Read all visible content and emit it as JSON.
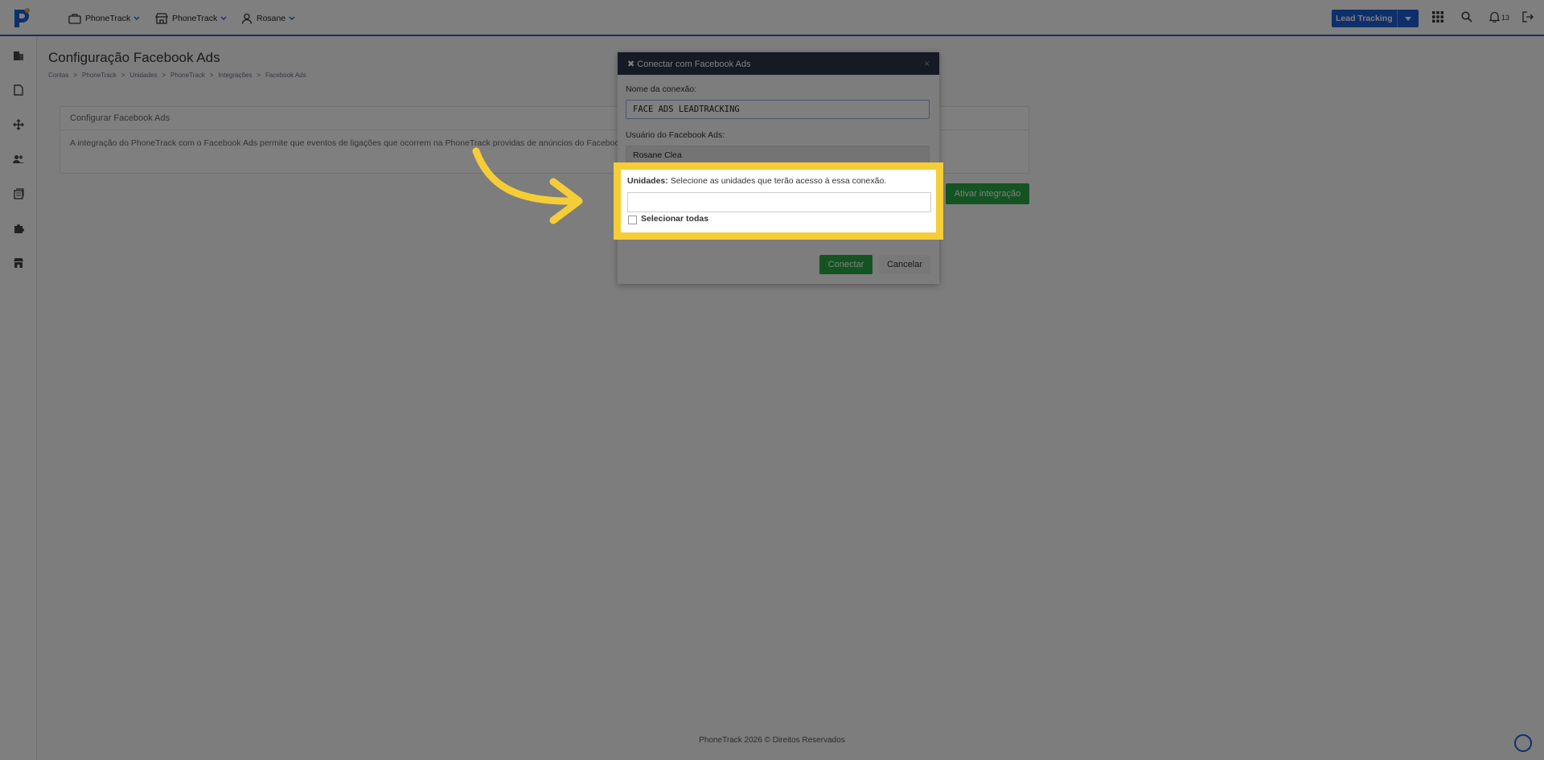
{
  "topbar": {
    "nav": [
      {
        "label": "PhoneTrack",
        "icon": "briefcase-icon"
      },
      {
        "label": "PhoneTrack",
        "icon": "store-icon"
      },
      {
        "label": "Rosane",
        "icon": "user-icon"
      }
    ],
    "lead_button_label": "Lead Tracking",
    "notification_count": "13"
  },
  "page": {
    "title": "Configuração Facebook Ads",
    "breadcrumb": [
      "Contas",
      "PhoneTrack",
      "Unidades",
      "PhoneTrack",
      "Integrações",
      "Facebook Ads"
    ],
    "panel_title": "Configurar Facebook Ads",
    "panel_text": "A integração do PhoneTrack com o Facebook Ads permite que eventos de ligações que ocorrem na PhoneTrack providas de anúncios do Facebook Ads sejam enviados automaticamente para o Facebook Ads.",
    "activate_label": "Ativar integração",
    "footer": "PhoneTrack 2026 © Direitos Reservados"
  },
  "modal": {
    "title": "✖ Conectar com Facebook Ads",
    "connection_name_label": "Nome da conexão:",
    "connection_name_value": "FACE ADS LEADTRACKING",
    "fb_user_label": "Usuário do Facebook Ads:",
    "fb_user_value": "Rosane Clea",
    "units_label": "Unidades:",
    "units_hint": "Selecione as unidades que terão acesso à essa conexão.",
    "select_all_label": "Selecionar todas",
    "connect_label": "Conectar",
    "cancel_label": "Cancelar"
  },
  "colors": {
    "accent": "#1d5fd6",
    "success": "#28a745",
    "highlight": "#f5cd37",
    "modal_header": "#2a344a"
  }
}
